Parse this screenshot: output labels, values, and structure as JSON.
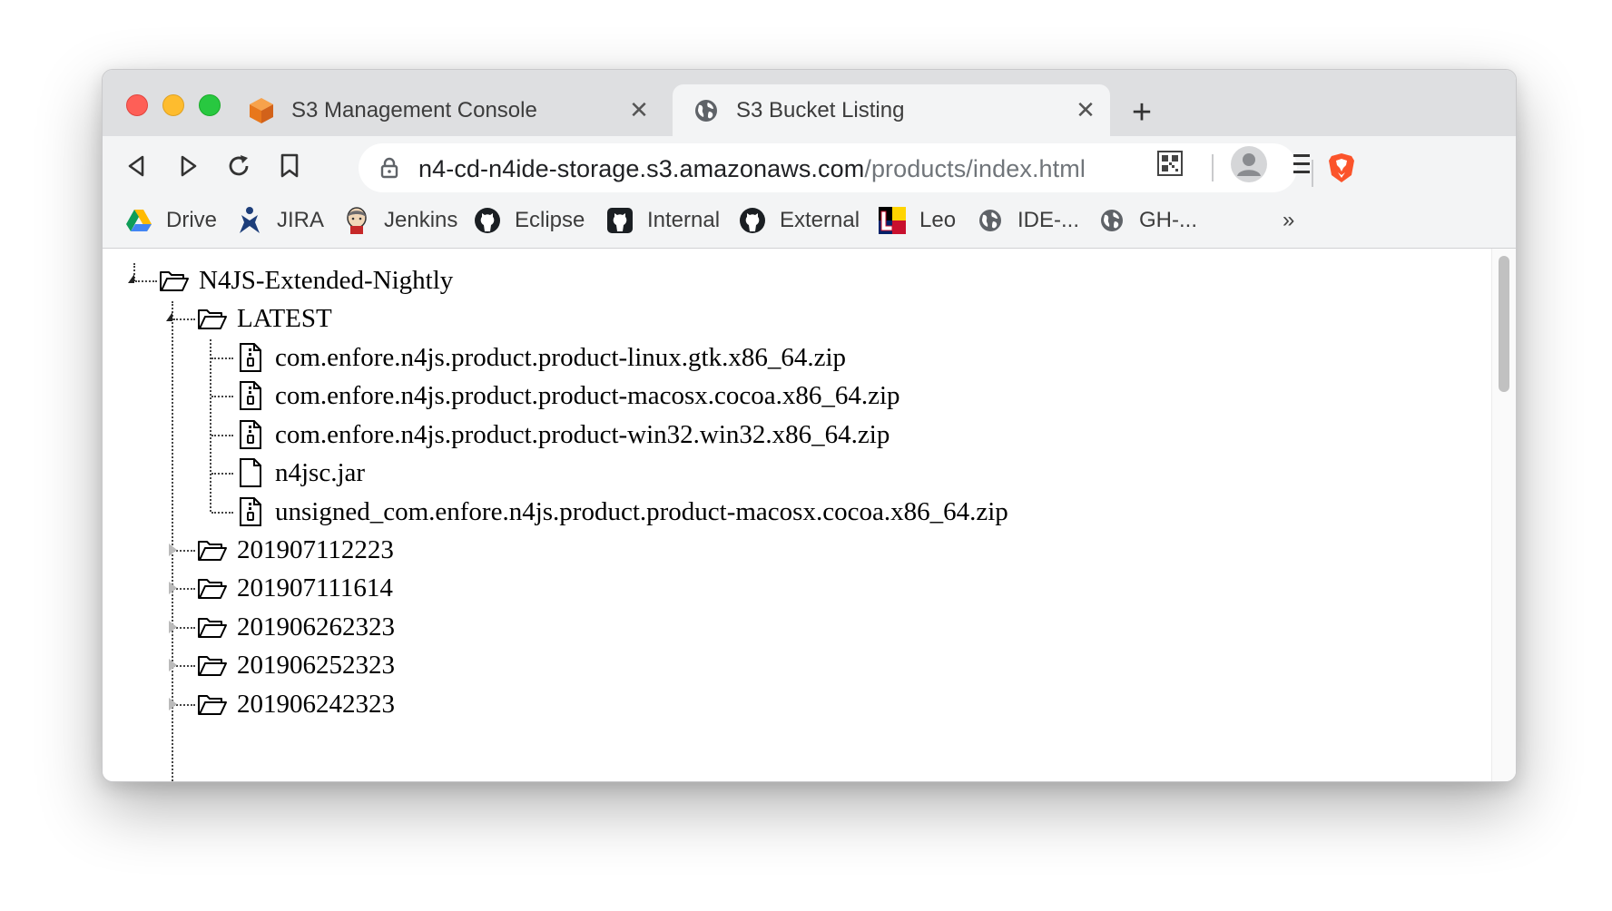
{
  "tabs": [
    {
      "title": "S3 Management Console",
      "favicon": "aws-s3-cube-icon",
      "active": false
    },
    {
      "title": "S3 Bucket Listing",
      "favicon": "globe-icon",
      "active": true
    }
  ],
  "toolbar": {
    "url_host": "n4-cd-n4ide-storage.s3.amazonaws.com",
    "url_path": "/products/index.html"
  },
  "bookmarks": [
    {
      "label": "Drive",
      "icon": "google-drive-icon"
    },
    {
      "label": "JIRA",
      "icon": "jira-icon"
    },
    {
      "label": "Jenkins",
      "icon": "jenkins-icon"
    },
    {
      "label": "Eclipse",
      "icon": "github-icon"
    },
    {
      "label": "Internal",
      "icon": "github-icon"
    },
    {
      "label": "External",
      "icon": "github-icon"
    },
    {
      "label": "Leo",
      "icon": "leo-dictionary-icon"
    },
    {
      "label": "IDE-...",
      "icon": "globe-icon"
    },
    {
      "label": "GH-...",
      "icon": "globe-icon"
    }
  ],
  "bookmarks_overflow": "»",
  "tree": {
    "root": "N4JS-Extended-Nightly",
    "latest": {
      "label": "LATEST",
      "files": [
        {
          "name": "com.enfore.n4js.product.product-linux.gtk.x86_64.zip",
          "type": "zip"
        },
        {
          "name": "com.enfore.n4js.product.product-macosx.cocoa.x86_64.zip",
          "type": "zip"
        },
        {
          "name": "com.enfore.n4js.product.product-win32.win32.x86_64.zip",
          "type": "zip"
        },
        {
          "name": "n4jsc.jar",
          "type": "file"
        },
        {
          "name": "unsigned_com.enfore.n4js.product.product-macosx.cocoa.x86_64.zip",
          "type": "zip"
        }
      ]
    },
    "folders": [
      "201907112223",
      "201907111614",
      "201906262323",
      "201906252323",
      "201906242323"
    ]
  }
}
